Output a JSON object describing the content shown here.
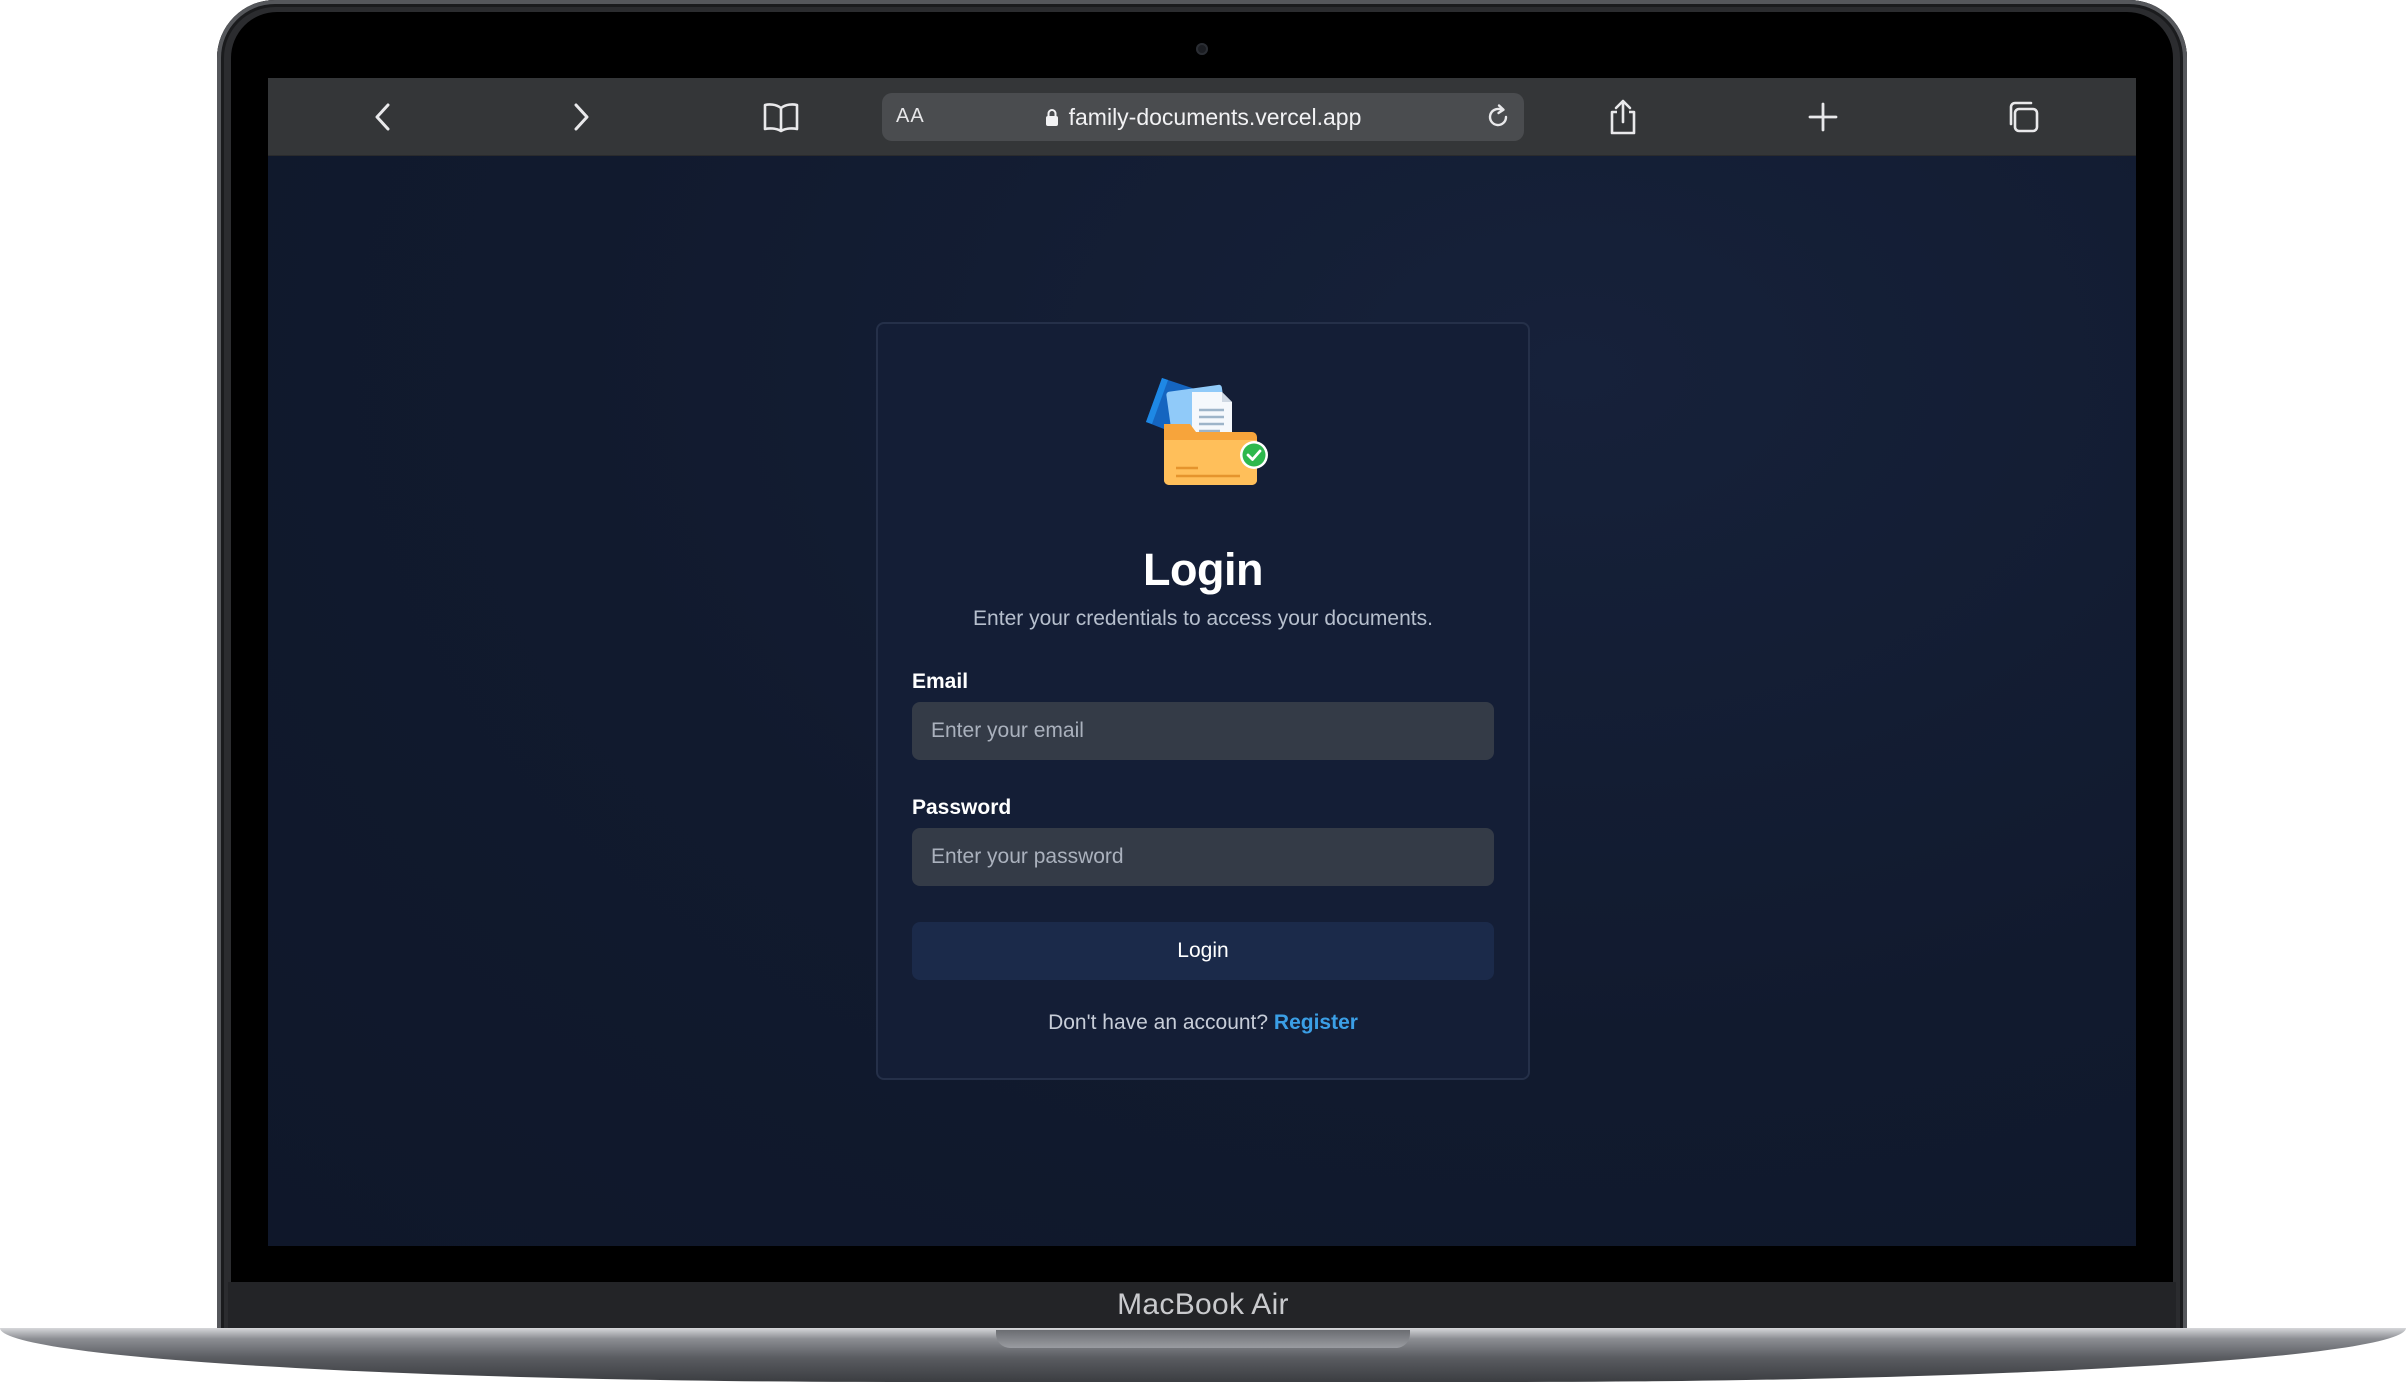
{
  "device": {
    "label": "MacBook Air"
  },
  "browser": {
    "reader_label": "AA",
    "url": "family-documents.vercel.app",
    "icons": [
      "chevron-left-icon",
      "chevron-right-icon",
      "book-icon",
      "lock-icon",
      "reload-icon",
      "share-icon",
      "plus-icon",
      "tabs-icon"
    ]
  },
  "login": {
    "title": "Login",
    "subtitle": "Enter your credentials to access your documents.",
    "email_label": "Email",
    "email_placeholder": "Enter your email",
    "password_label": "Password",
    "password_placeholder": "Enter your password",
    "submit_label": "Login",
    "footer_text": "Don't have an account?",
    "register_link": "Register"
  },
  "colors": {
    "page_background": "#111a2e",
    "card_background": "#141e36",
    "input_background": "#343b47",
    "button_background": "#1b2a4a",
    "link": "#3b9fe6"
  }
}
